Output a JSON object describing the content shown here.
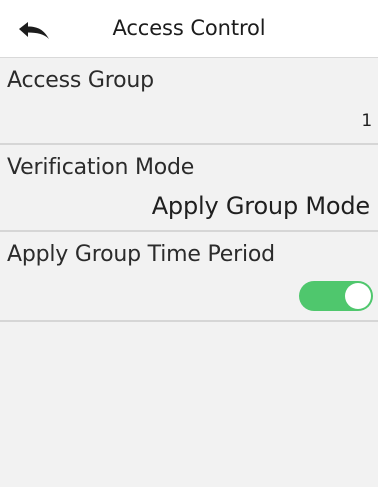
{
  "header": {
    "title": "Access Control"
  },
  "icons": {
    "back": "back-arrow-icon"
  },
  "items": [
    {
      "label": "Access Group",
      "value": "1"
    },
    {
      "label": "Verification Mode",
      "value": "Apply Group Mode"
    },
    {
      "label": "Apply Group Time Period",
      "toggle_on": true
    }
  ],
  "colors": {
    "toggle_on": "#4fc76d",
    "background": "#f2f2f2",
    "header_bg": "#ffffff"
  }
}
